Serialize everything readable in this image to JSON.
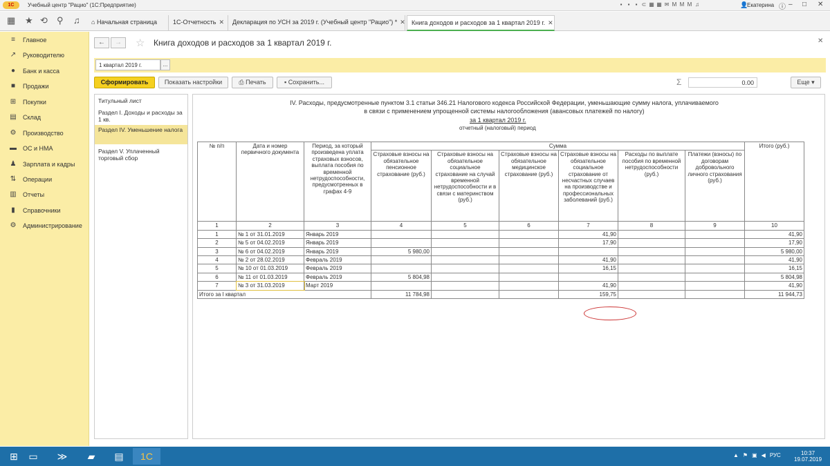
{
  "titlebar": {
    "logo": "1С",
    "title": "Учебный центр \"Рацио\" (1С:Предприятие)",
    "user": "Екатерина"
  },
  "tabs": [
    {
      "label": "Начальная страница"
    },
    {
      "label": "1С-Отчетность"
    },
    {
      "label": "Декларация по УСН за 2019 г. (Учебный центр \"Рацио\") *"
    },
    {
      "label": "Книга доходов и расходов за 1 квартал 2019 г."
    }
  ],
  "sidebar": {
    "items": [
      {
        "label": "Главное",
        "icon": "menu-icon"
      },
      {
        "label": "Руководителю",
        "icon": "trend-icon"
      },
      {
        "label": "Банк и касса",
        "icon": "coins-icon"
      },
      {
        "label": "Продажи",
        "icon": "bag-icon"
      },
      {
        "label": "Покупки",
        "icon": "cart-icon"
      },
      {
        "label": "Склад",
        "icon": "warehouse-icon"
      },
      {
        "label": "Производство",
        "icon": "factory-icon"
      },
      {
        "label": "ОС и НМА",
        "icon": "assets-icon"
      },
      {
        "label": "Зарплата и кадры",
        "icon": "people-icon"
      },
      {
        "label": "Операции",
        "icon": "operations-icon"
      },
      {
        "label": "Отчеты",
        "icon": "report-icon"
      },
      {
        "label": "Справочники",
        "icon": "book-icon"
      },
      {
        "label": "Администрирование",
        "icon": "gear-icon"
      }
    ]
  },
  "document": {
    "title": "Книга доходов и расходов за 1 квартал 2019 г."
  },
  "period": {
    "value": "1 квартал 2019 г.",
    "btn": "..."
  },
  "toolbar": {
    "generate": "Сформировать",
    "settings": "Показать настройки",
    "print": "Печать",
    "save": "Сохранить...",
    "sigma": "Σ",
    "sum": "0.00",
    "more": "Еще"
  },
  "sections": [
    {
      "label": "Титульный лист"
    },
    {
      "label": "Раздел I. Доходы и расходы за 1 кв."
    },
    {
      "label": "Раздел IV. Уменьшение налога"
    },
    {
      "label": "Раздел V. Уплаченный торговый сбор"
    }
  ],
  "report": {
    "title": "IV. Расходы, предусмотренные пунктом 3.1 статьи 346.21 Налогового кодекса Российской Федерации, уменьшающие сумму налога, уплачиваемого в связи с применением упрощенной системы налогообложения (авансовых платежей по налогу)",
    "period": "за 1 квартал 2019 г.",
    "period_caption": "отчетный (налоговый) период",
    "headers": {
      "num": "№ п/п",
      "date": "Дата и номер первичного документа",
      "period": "Период, за который произведена уплата страховых взносов, выплата пособия по временной нетрудоспособности, предусмотренных в графах 4-9",
      "sum": "Сумма",
      "total": "Итого (руб.)",
      "c4": "Страховые взносы на обязательное пенсионное страхование (руб.)",
      "c5": "Страховые взносы на обязательное социальное страхование на случай временной нетрудоспособности и в связи с материнством (руб.)",
      "c6": "Страховые взносы на обязательное медицинское страхование (руб.)",
      "c7": "Страховые взносы на обязательное социальное страхование от несчастных случаев на производстве и профессиональных заболеваний (руб.)",
      "c8": "Расходы по выплате пособия по временной нетрудоспособности (руб.)",
      "c9": "Платежи (взносы) по договорам добровольного личного страхования (руб.)"
    },
    "colnums": [
      "1",
      "2",
      "3",
      "4",
      "5",
      "6",
      "7",
      "8",
      "9",
      "10"
    ],
    "rows": [
      {
        "n": "1",
        "doc": "№ 1 от 31.01.2019",
        "per": "Январь 2019",
        "c4": "",
        "c7": "41,90",
        "tot": "41,90"
      },
      {
        "n": "2",
        "doc": "№ 5 от 04.02.2019",
        "per": "Январь 2019",
        "c4": "",
        "c7": "17,90",
        "tot": "17,90"
      },
      {
        "n": "3",
        "doc": "№ 6 от 04.02.2019",
        "per": "Январь 2019",
        "c4": "5 980,00",
        "c7": "",
        "tot": "5 980,00"
      },
      {
        "n": "4",
        "doc": "№ 2 от 28.02.2019",
        "per": "Февраль 2019",
        "c4": "",
        "c7": "41,90",
        "tot": "41,90"
      },
      {
        "n": "5",
        "doc": "№ 10 от 01.03.2019",
        "per": "Февраль 2019",
        "c4": "",
        "c7": "16,15",
        "tot": "16,15"
      },
      {
        "n": "6",
        "doc": "№ 11 от 01.03.2019",
        "per": "Февраль 2019",
        "c4": "5 804,98",
        "c7": "",
        "tot": "5 804,98"
      },
      {
        "n": "7",
        "doc": "№ 3 от 31.03.2019",
        "per": "Март 2019",
        "c4": "",
        "c7": "41,90",
        "tot": "41,90"
      }
    ],
    "total": {
      "label": "Итого за I квартал",
      "c4": "11 784,98",
      "c7": "159,75",
      "tot": "11 944,73"
    }
  },
  "taskbar": {
    "lang": "РУС",
    "time": "10:37",
    "date": "19.07.2019"
  }
}
